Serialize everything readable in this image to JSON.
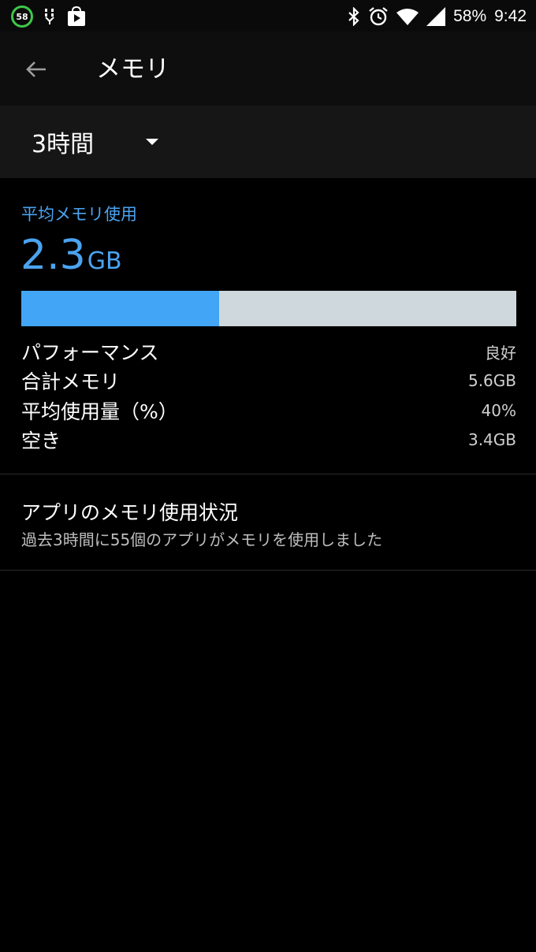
{
  "status_bar": {
    "notification_badge": "58",
    "battery_percent": "58%",
    "time": "9:42",
    "icons_left": [
      "circle-58-icon",
      "usb-debug-icon",
      "play-store-icon"
    ],
    "icons_right": [
      "bluetooth-icon",
      "alarm-icon",
      "wifi-icon",
      "signal-icon"
    ]
  },
  "app_bar": {
    "title": "メモリ",
    "back_icon": "arrow-back-icon"
  },
  "period_spinner": {
    "selected": "3時間"
  },
  "summary": {
    "avg_label": "平均メモリ使用",
    "avg_value": "2.3",
    "avg_unit": "GB",
    "usage_fraction": 0.4,
    "colors": {
      "accent": "#42a5f5",
      "bar_bg": "#cfd8dc"
    },
    "stats": [
      {
        "label": "パフォーマンス",
        "value": "良好"
      },
      {
        "label": "合計メモリ",
        "value": "5.6GB"
      },
      {
        "label": "平均使用量（%）",
        "value": "40%"
      },
      {
        "label": "空き",
        "value": "3.4GB"
      }
    ]
  },
  "app_usage": {
    "title": "アプリのメモリ使用状況",
    "subtitle": "過去3時間に55個のアプリがメモリを使用しました"
  }
}
